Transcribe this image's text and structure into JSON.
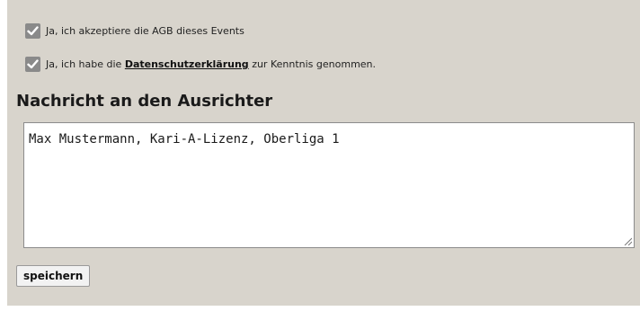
{
  "consents": {
    "agb": {
      "checked": true,
      "label": "Ja, ich akzeptiere die AGB dieses Events"
    },
    "privacy": {
      "checked": true,
      "label_before": "Ja, ich habe die",
      "link": "Datenschutzerklärung",
      "label_after": "zur Kenntnis genommen."
    }
  },
  "message": {
    "heading": "Nachricht an den Ausrichter",
    "value": "Max Mustermann, Kari-A-Lizenz, Oberliga 1"
  },
  "actions": {
    "save_label": "speichern"
  },
  "icons": {
    "checkbox": "checkmark-icon",
    "textarea_resize": "resize-grip-icon"
  },
  "colors": {
    "panel_background": "#d8d4cc",
    "checkbox_fill": "#8a8a8a"
  }
}
